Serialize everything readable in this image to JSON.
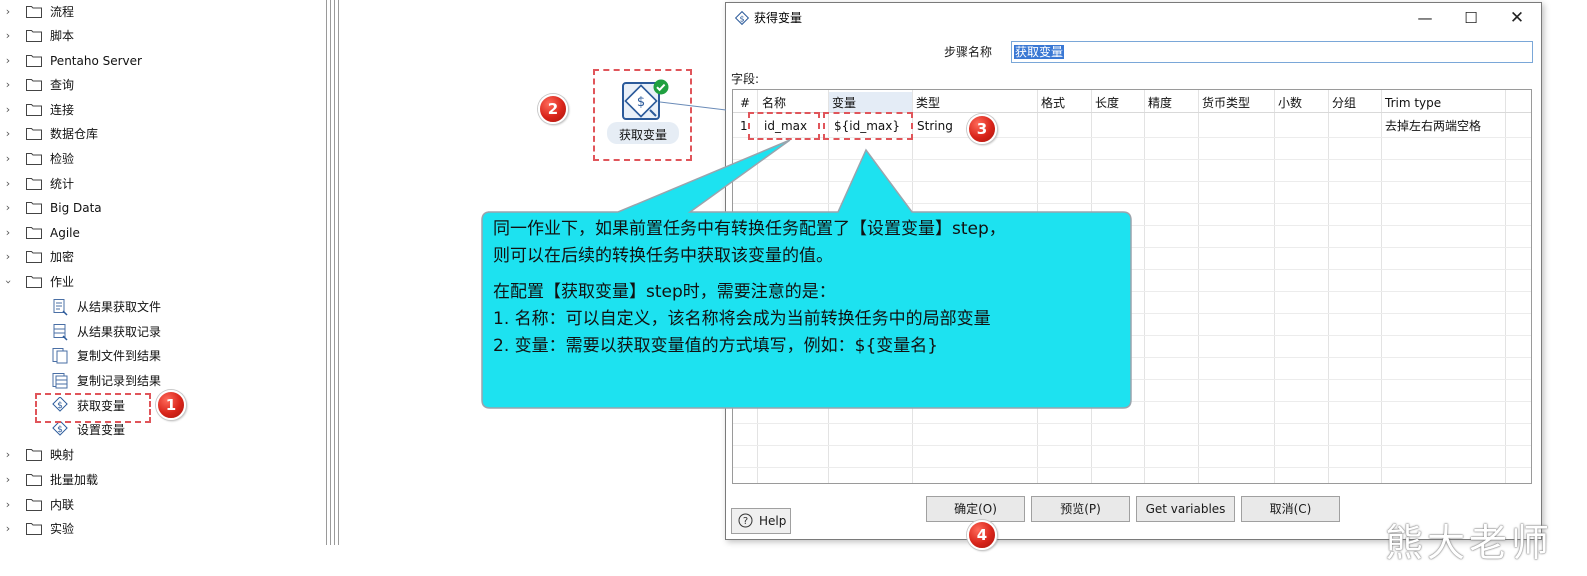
{
  "tree": {
    "items": [
      {
        "label": "流程"
      },
      {
        "label": "脚本"
      },
      {
        "label": "Pentaho Server"
      },
      {
        "label": "查询"
      },
      {
        "label": "连接"
      },
      {
        "label": "数据仓库"
      },
      {
        "label": "检验"
      },
      {
        "label": "统计"
      },
      {
        "label": "Big Data"
      },
      {
        "label": "Agile"
      },
      {
        "label": "加密"
      },
      {
        "label": "作业"
      },
      {
        "label": "映射"
      },
      {
        "label": "批量加载"
      },
      {
        "label": "内联"
      },
      {
        "label": "实验"
      }
    ],
    "job_children": [
      {
        "label": "从结果获取文件"
      },
      {
        "label": "从结果获取记录"
      },
      {
        "label": "复制文件到结果"
      },
      {
        "label": "复制记录到结果"
      },
      {
        "label": "获取变量"
      },
      {
        "label": "设置变量"
      }
    ]
  },
  "badges": {
    "b1": "1",
    "b2": "2",
    "b3": "3",
    "b4": "4"
  },
  "canvas_step": {
    "label": "获取变量"
  },
  "dialog": {
    "title": "获得变量",
    "step_name_label": "步骤名称",
    "step_name_value": "获取变量",
    "fields_label": "字段:",
    "columns": [
      "#",
      "名称",
      "变量",
      "类型",
      "格式",
      "长度",
      "精度",
      "货币类型",
      "小数",
      "分组",
      "Trim type"
    ],
    "rows": [
      {
        "num": "1",
        "name": "id_max",
        "variable": "${id_max}",
        "type": "String",
        "trim": "去掉左右两端空格"
      }
    ],
    "help_label": "Help",
    "buttons": {
      "ok": "确定(O)",
      "preview": "预览(P)",
      "get_vars": "Get variables",
      "cancel": "取消(C)"
    }
  },
  "callout": {
    "line1": "同一作业下，如果前置任务中有转换任务配置了【设置变量】step，",
    "line2": "则可以在后续的转换任务中获取该变量的值。",
    "line3": "在配置【获取变量】step时，需要注意的是：",
    "line4": "1. 名称：可以自定义，该名称将会成为当前转换任务中的局部变量",
    "line5": "2. 变量：需要以获取变量值的方式填写，例如：${变量名}"
  },
  "watermark": "熊大老师",
  "colors": {
    "callout_fill": "#1de2f0",
    "badge_red": "#d8241a",
    "dash_red": "#e0555a",
    "highlight": "#3a78d4"
  }
}
